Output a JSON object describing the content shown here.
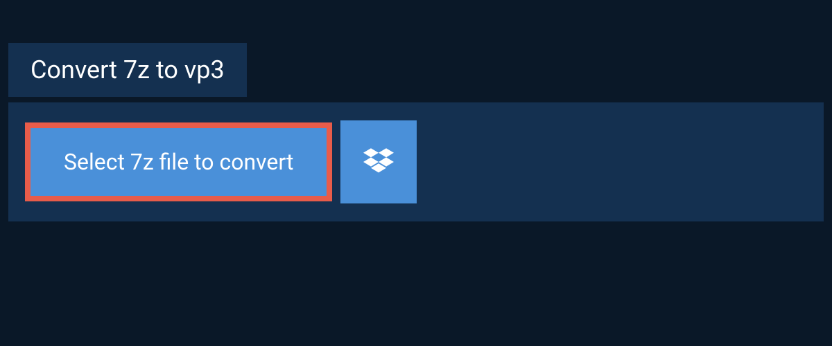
{
  "header": {
    "tab_label": "Convert 7z to vp3"
  },
  "actions": {
    "select_file_label": "Select 7z file to convert"
  },
  "icons": {
    "dropbox": "dropbox-icon"
  },
  "colors": {
    "background": "#0a1828",
    "panel": "#143050",
    "button": "#4a90d9",
    "highlight_border": "#e85c4a"
  }
}
